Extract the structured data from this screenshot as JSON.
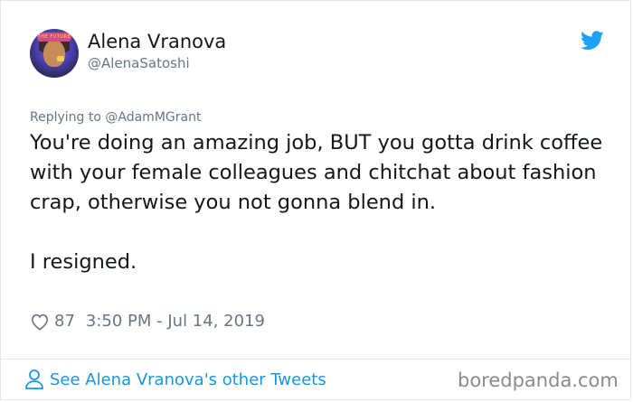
{
  "user": {
    "display_name": "Alena Vranova",
    "handle": "@AlenaSatoshi",
    "avatar_icon": "profile-avatar",
    "avatar_band_text": "THE FUTURE"
  },
  "tweet": {
    "replying_to": "Replying to @AdamMGrant",
    "text": "You're doing an amazing job, BUT you gotta drink coffee with your female colleagues and chitchat about fashion crap, otherwise you not gonna blend in.\n\nI resigned.",
    "likes": "87",
    "timestamp": "3:50 PM - Jul 14, 2019"
  },
  "footer": {
    "see_more": "See Alena Vranova's other Tweets",
    "watermark": "boredpanda.com"
  },
  "colors": {
    "twitter_blue": "#1da1f2",
    "link_blue": "#1b95e0",
    "muted": "#657786",
    "text": "#14171a"
  }
}
